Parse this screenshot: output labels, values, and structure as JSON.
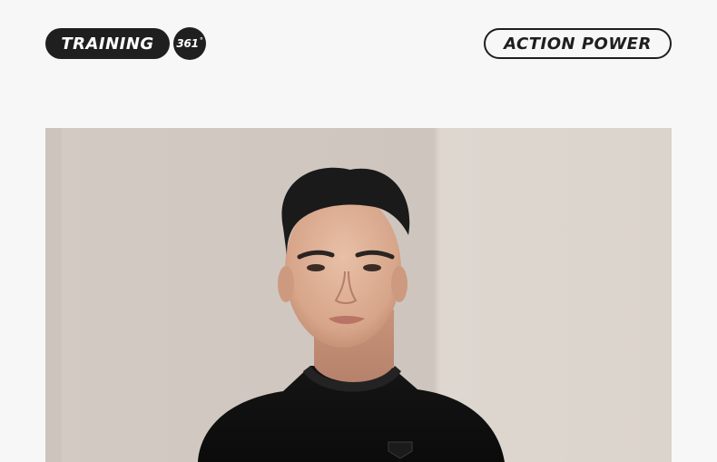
{
  "header": {
    "training_label": "TRAINING",
    "logo_text": "361",
    "logo_degree": "°",
    "action_label": "ACTION POWER"
  },
  "photo": {
    "subject": "man-in-black-sweatshirt"
  },
  "colors": {
    "page_background": "#f7f7f7",
    "pill_dark": "#1f1f1f",
    "photo_backdrop": "#cfc7bf",
    "shirt": "#111111"
  }
}
